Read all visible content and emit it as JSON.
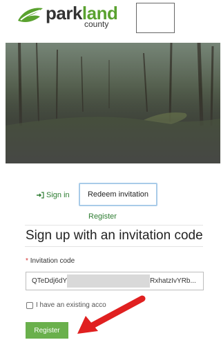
{
  "brand": {
    "name_part1": "park",
    "name_part2": "land",
    "name_sub": "county",
    "accent": "#5aa22f"
  },
  "nav": {
    "signin_label": "Sign in",
    "redeem_label": "Redeem invitation",
    "register_label": "Register"
  },
  "form": {
    "heading": "Sign up with an invitation code",
    "code_label": "Invitation code",
    "code_value_start": "QTeDdj6dY",
    "code_value_end": "RxhatzIvYRb...",
    "existing_account_label": "I have an existing acco",
    "submit_label": "Register"
  },
  "colors": {
    "link": "#2e7d32",
    "button": "#6ab04c",
    "arrow": "#e02020"
  }
}
